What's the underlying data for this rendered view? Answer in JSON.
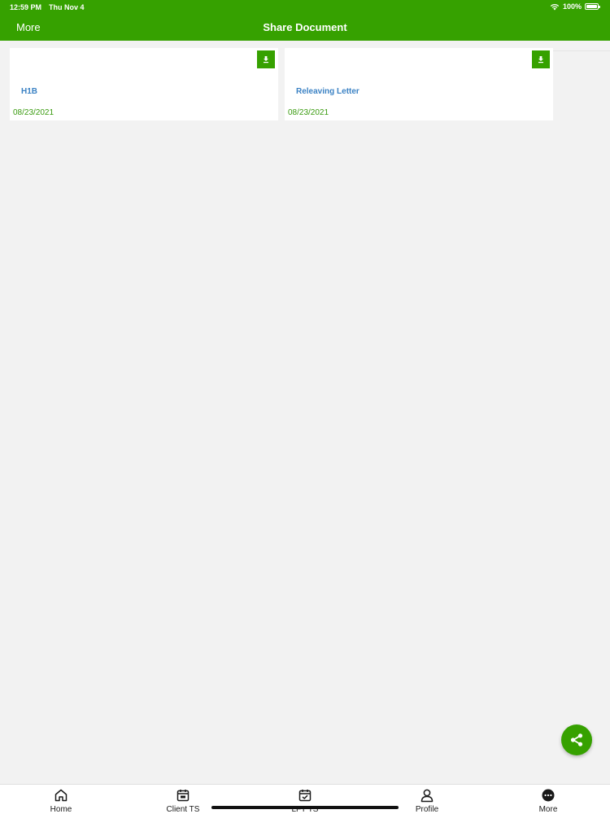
{
  "status_bar": {
    "time": "12:59 PM",
    "date": "Thu Nov 4",
    "battery": "100%"
  },
  "header": {
    "back_label": "More",
    "title": "Share Document"
  },
  "documents": [
    {
      "name": "H1B",
      "date": "08/23/2021"
    },
    {
      "name": "Releaving Letter",
      "date": "08/23/2021"
    }
  ],
  "tabs": [
    {
      "label": "Home",
      "icon": "home-icon"
    },
    {
      "label": "Client TS",
      "icon": "calendar-icon"
    },
    {
      "label": "LFT TS",
      "icon": "calendar-check-icon"
    },
    {
      "label": "Profile",
      "icon": "user-icon"
    },
    {
      "label": "More",
      "icon": "more-icon"
    }
  ],
  "colors": {
    "primary": "#36a100",
    "link": "#3b82c4",
    "date": "#3a9b10",
    "background": "#f2f2f2"
  }
}
